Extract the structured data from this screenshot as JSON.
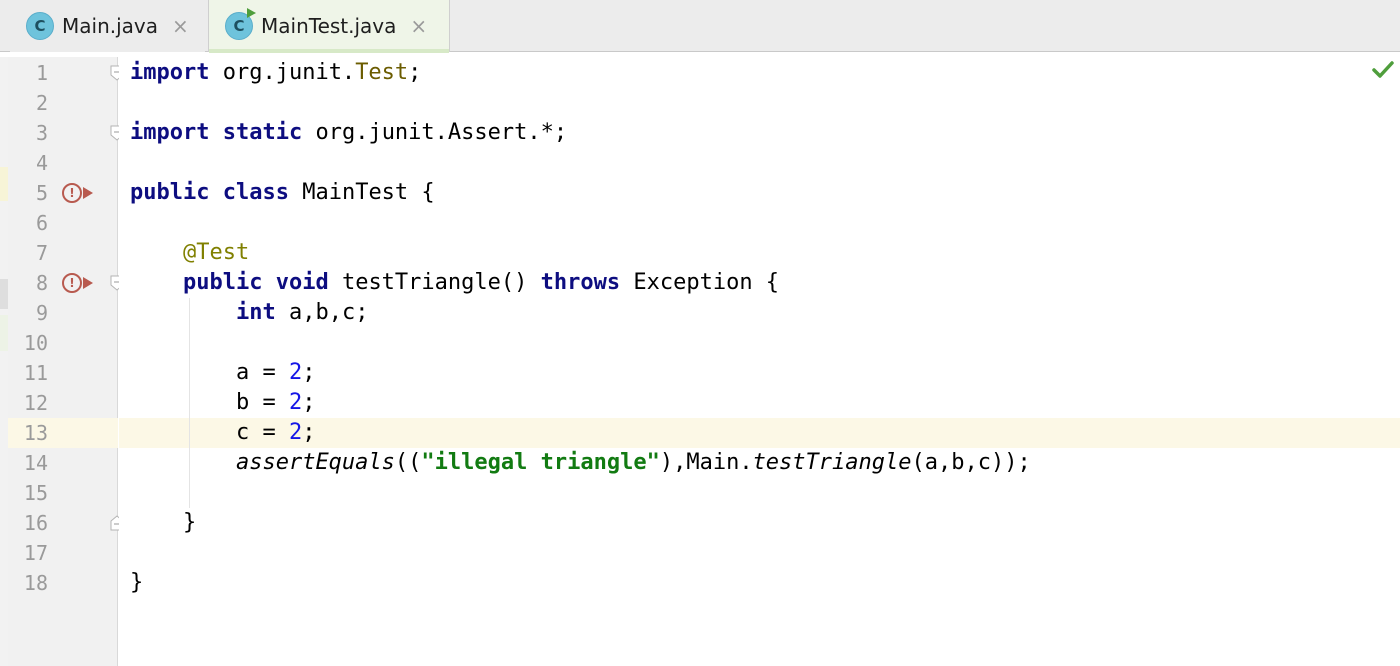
{
  "tabs": [
    {
      "label": "Main.java",
      "icon_letter": "C",
      "active": false
    },
    {
      "label": "MainTest.java",
      "icon_letter": "C",
      "active": true
    }
  ],
  "tab_close_glyph": "×",
  "line_numbers": [
    "1",
    "2",
    "3",
    "4",
    "5",
    "6",
    "7",
    "8",
    "9",
    "10",
    "11",
    "12",
    "13",
    "14",
    "15",
    "16",
    "17",
    "18"
  ],
  "code": {
    "l1": {
      "kw1": "import",
      "t1": " org.junit.",
      "type": "Test",
      "t2": ";"
    },
    "l3": {
      "kw1": "import",
      "kw2": "static",
      "t1": " org.junit.Assert.*;"
    },
    "l5": {
      "kw1": "public",
      "kw2": "class",
      "t1": " MainTest {"
    },
    "l7": {
      "ann": "@Test"
    },
    "l8": {
      "kw1": "public",
      "kw2": "void",
      "t1": " testTriangle() ",
      "kw3": "throws",
      "t2": " Exception {"
    },
    "l9": {
      "kw1": "int",
      "t1": " a,b,c;"
    },
    "l11": {
      "t1": "a = ",
      "num": "2",
      "t2": ";"
    },
    "l12": {
      "t1": "b = ",
      "num": "2",
      "t2": ";"
    },
    "l13": {
      "t1": "c = ",
      "num": "2",
      "t2": ";"
    },
    "l14": {
      "call": "assertEquals",
      "t1": "((",
      "str": "\"illegal triangle\"",
      "t2": "),Main.",
      "call2": "testTriangle",
      "t3": "(a,b,c));"
    },
    "l16": {
      "t1": "}"
    },
    "l18": {
      "t1": "}"
    }
  },
  "gutter": {
    "run_markers_on_lines": [
      "5",
      "8"
    ],
    "run_marker_glyph": "!",
    "intention_bulb_on_line": "13",
    "fold_markers_on_lines": [
      "1",
      "3",
      "8",
      "16"
    ]
  },
  "status": {
    "analysis_icon": "check-icon",
    "state": "no-problems"
  },
  "colors": {
    "keyword": "#0d0d80",
    "annotation": "#808000",
    "string": "#127b12",
    "number": "#1616e6",
    "caret_row": "#fcf8e6",
    "active_tab": "#eff5e8",
    "run_marker": "#b85a4f",
    "check": "#4f9e3c"
  }
}
